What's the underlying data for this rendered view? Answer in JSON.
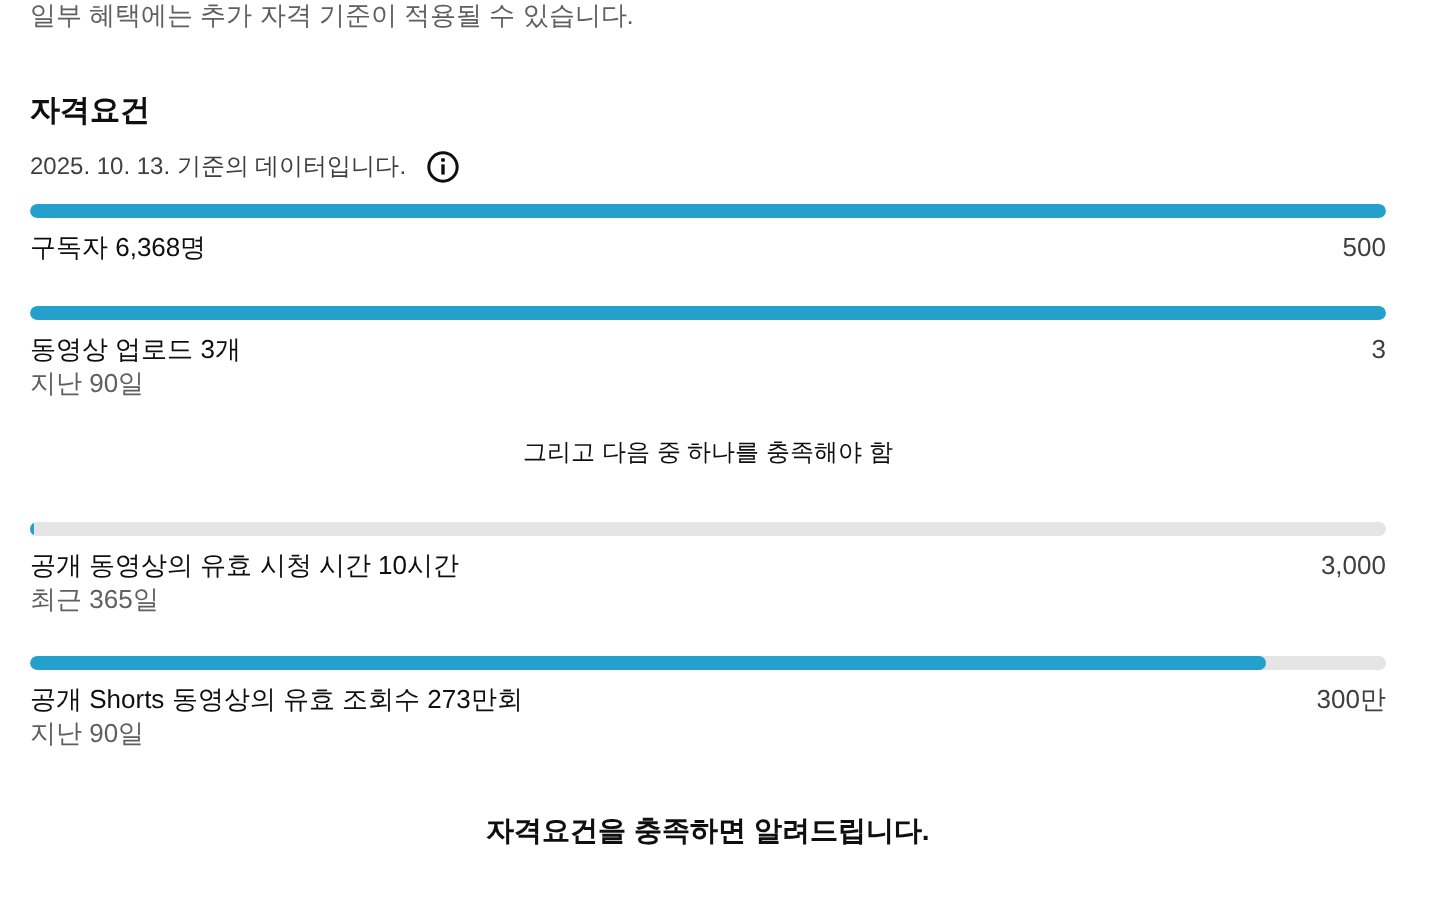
{
  "notice": "일부 혜택에는 추가 자격 기준이 적용될 수 있습니다.",
  "section": {
    "title": "자격요건",
    "data_date": "2025. 10. 13. 기준의 데이터입니다."
  },
  "required": [
    {
      "label": "구독자 6,368명",
      "target": "500",
      "level": 1
    },
    {
      "label": "동영상 업로드 3개",
      "sublabel": "지난 90일",
      "target": "3",
      "level": 1
    }
  ],
  "divider_text": "그리고 다음 중 하나를 충족해야 함",
  "alternatives": [
    {
      "label": "공개 동영상의 유효 시청 시간 10시간",
      "sublabel": "최근 365일",
      "target": "3,000",
      "level": 0.003
    },
    {
      "label": "공개 Shorts 동영상의 유효 조회수 273만회",
      "sublabel": "지난 90일",
      "target": "300만",
      "level": 0.911
    }
  ],
  "footer": "자격요건을 충족하면 알려드립니다."
}
